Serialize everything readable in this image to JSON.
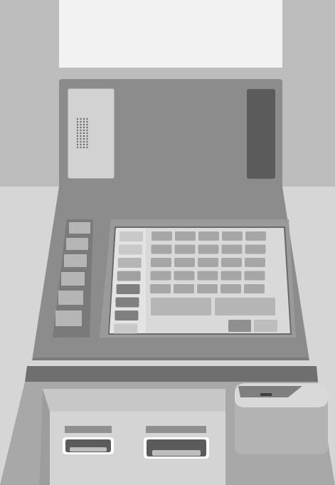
{
  "scene": {
    "label": "",
    "colors": {
      "wall_upper": "#bdbdbd",
      "wall_lower": "#d6d6d6",
      "top_panel": "#f2f2f2",
      "housing": "#8c8c8c",
      "housing_dark": "#6f6f6f",
      "screen_bezel": "#9a9a9a",
      "screen": "#d9d9d9",
      "key_light": "#b5b5b5",
      "key_dark": "#7f7f7f",
      "slot_dark": "#5b5b5b",
      "counter": "#a8a8a8",
      "counter_front": "#c7c7c7",
      "speaker_panel": "#d2d2d2",
      "outline": "#ffffff"
    },
    "icons": {
      "speaker": "speaker-icon",
      "card_reader": "card-reader-icon",
      "cash_slot": "cash-dispenser-icon",
      "receipt_slot": "receipt-slot-icon"
    }
  }
}
